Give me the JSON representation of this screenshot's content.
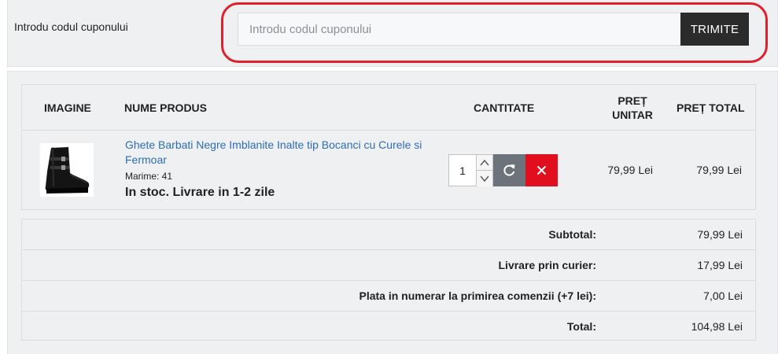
{
  "coupon": {
    "label": "Introdu codul cuponului",
    "placeholder": "Introdu codul cuponului",
    "value": "",
    "submit_label": "TRIMITE",
    "highlight_color": "#e0202b"
  },
  "cart": {
    "columns": {
      "image": "IMAGINE",
      "name": "NUME PRODUS",
      "quantity": "CANTITATE",
      "unit_price": "PREȚ UNITAR",
      "total_price": "PREȚ TOTAL"
    },
    "items": [
      {
        "name": "Ghete Barbati Negre Imblanite Inalte tip Bocanci cu Curele si Fermoar",
        "size": "Marime: 41",
        "stock": "In stoc. Livrare in 1-2 zile",
        "quantity": "1",
        "unit_price": "79,99 Lei",
        "total_price": "79,99 Lei",
        "image_icon": "black-boot-image"
      }
    ],
    "icons": {
      "increment": "chevron-up-icon",
      "decrement": "chevron-down-icon",
      "refresh": "refresh-icon",
      "remove": "close-icon"
    },
    "colors": {
      "link": "#2f6db2",
      "refresh_button": "#6c737b",
      "remove_button": "#e10e1d"
    }
  },
  "totals": [
    {
      "label": "Subtotal:",
      "value": "79,99 Lei"
    },
    {
      "label": "Livrare prin curier:",
      "value": "17,99 Lei"
    },
    {
      "label": "Plata in numerar la primirea comenzii (+7 lei):",
      "value": "7,00 Lei"
    },
    {
      "label": "Total:",
      "value": "104,98 Lei"
    }
  ]
}
